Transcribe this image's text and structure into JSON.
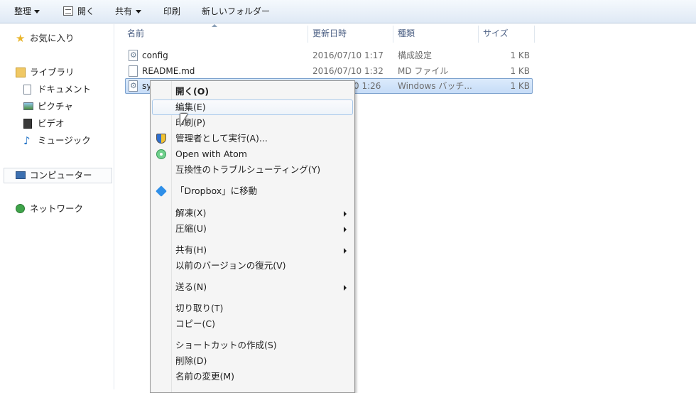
{
  "toolbar": {
    "organize": "整理",
    "open": "開く",
    "share": "共有",
    "print": "印刷",
    "new_folder": "新しいフォルダー"
  },
  "sidebar": {
    "favorites": "お気に入り",
    "libraries": "ライブラリ",
    "documents": "ドキュメント",
    "pictures": "ピクチャ",
    "videos": "ビデオ",
    "music": "ミュージック",
    "computer": "コンピューター",
    "network": "ネットワーク"
  },
  "columns": {
    "name": "名前",
    "date": "更新日時",
    "type": "種類",
    "size": "サイズ"
  },
  "files": [
    {
      "name": "config",
      "date": "2016/07/10 1:17",
      "type": "構成設定",
      "size": "1 KB"
    },
    {
      "name": "README.md",
      "date": "2016/07/10 1:32",
      "type": "MD ファイル",
      "size": "1 KB"
    },
    {
      "name": "sy",
      "date": "0 1:26",
      "type": "Windows バッチ...",
      "size": "1 KB"
    }
  ],
  "menu": {
    "open": "開く(O)",
    "edit": "編集(E)",
    "print": "印刷(P)",
    "run_as_admin": "管理者として実行(A)...",
    "open_with_atom": "Open with Atom",
    "troubleshoot": "互換性のトラブルシューティング(Y)",
    "move_to_dropbox": "「Dropbox」に移動",
    "extract": "解凍(X)",
    "compress": "圧縮(U)",
    "share_with": "共有(H)",
    "restore_versions": "以前のバージョンの復元(V)",
    "send_to": "送る(N)",
    "cut": "切り取り(T)",
    "copy": "コピー(C)",
    "create_shortcut": "ショートカットの作成(S)",
    "delete": "削除(D)",
    "rename": "名前の変更(M)"
  },
  "icons": {
    "favorites": "star-icon",
    "libraries": "library-icon",
    "documents": "document-icon",
    "pictures": "picture-icon",
    "videos": "video-icon",
    "music": "music-note-icon",
    "computer": "computer-icon",
    "network": "network-icon",
    "admin": "uac-shield-icon",
    "atom": "atom-icon",
    "dropbox": "dropbox-icon"
  },
  "colors": {
    "toolbar_bg": "#dfe9f5",
    "selection_bg": "#c6dcf7",
    "selection_border": "#7da2ce",
    "header_text": "#4d6185",
    "menu_bg": "#f5f5f5"
  }
}
